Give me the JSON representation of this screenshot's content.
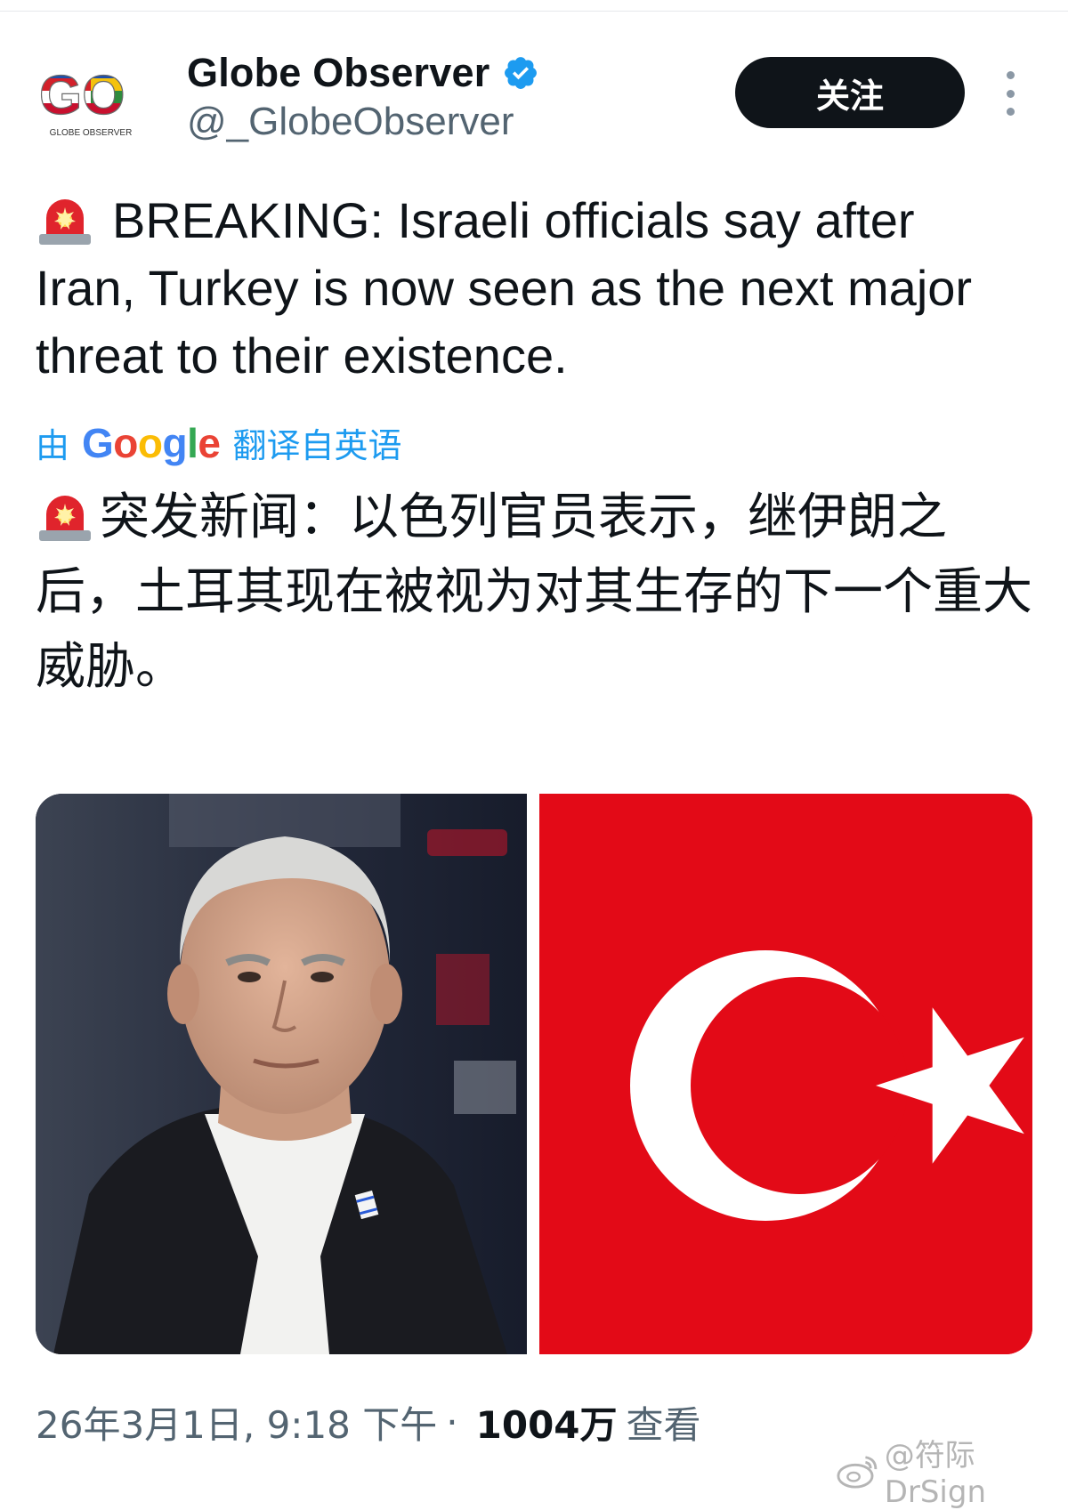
{
  "account": {
    "display_name": "Globe Observer",
    "handle": "@_GlobeObserver",
    "avatar_text": "GO",
    "avatar_caption": "GLOBE OBSERVER",
    "verified": true
  },
  "actions": {
    "follow_label": "关注"
  },
  "tweet": {
    "text_en": "BREAKING: Israeli officials say after Iran, Turkey is now seen as the next major threat to their existence.",
    "translate_prefix": "由",
    "translate_brand": "Google",
    "translate_suffix": "翻译自英语",
    "text_zh": "突发新闻：以色列官员表示，继伊朗之后，土耳其现在被视为对其生存的下一个重大威胁。"
  },
  "media": [
    {
      "icon": "portrait-photo-icon"
    },
    {
      "icon": "turkish-flag-icon"
    }
  ],
  "meta": {
    "timestamp": "26年3月1日, 9:18 下午",
    "separator": "·",
    "views_count": "1004万",
    "views_label": "查看"
  },
  "watermark": {
    "text": "@符际DrSign"
  },
  "colors": {
    "link": "#1d9bf0",
    "verified": "#1d9bf0",
    "flag_red": "#e30a17",
    "button_bg": "#0f1419"
  }
}
